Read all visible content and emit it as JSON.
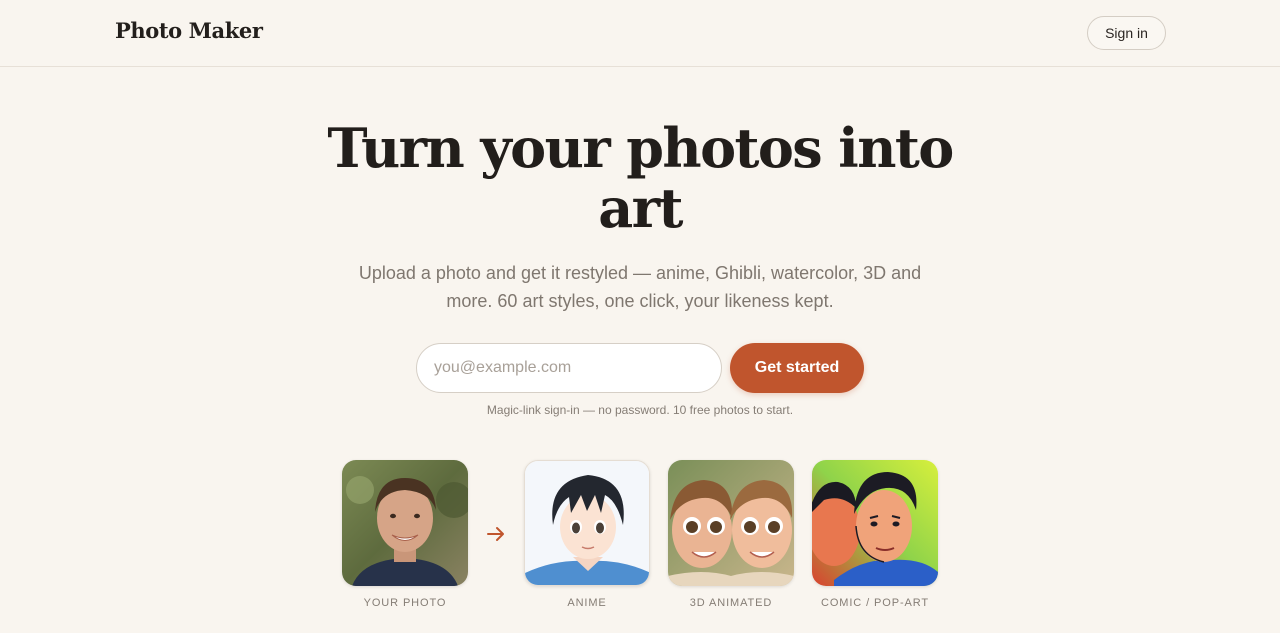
{
  "header": {
    "brand": "Photo Maker",
    "signin_label": "Sign in"
  },
  "hero": {
    "title": "Turn your photos into art",
    "subtitle": "Upload a photo and get it restyled — anime, Ghibli, watercolor, 3D and more. 60 art styles, one click, your likeness kept.",
    "email_placeholder": "you@example.com",
    "email_value": "",
    "cta_label": "Get started",
    "note": "Magic-link sign-in — no password. 10 free photos to start."
  },
  "examples": [
    {
      "caption": "YOUR PHOTO",
      "icon": "portrait-photo"
    },
    {
      "caption": "ANIME",
      "icon": "anime-portrait"
    },
    {
      "caption": "3D ANIMATED",
      "icon": "3d-animated-portrait"
    },
    {
      "caption": "COMIC / POP-ART",
      "icon": "comic-pop-art-portrait"
    }
  ],
  "arrow_icon": "arrow-right-icon",
  "colors": {
    "accent": "#c0552d",
    "background": "#f9f5ef",
    "text": "#221e1b",
    "muted": "#7f776f"
  }
}
